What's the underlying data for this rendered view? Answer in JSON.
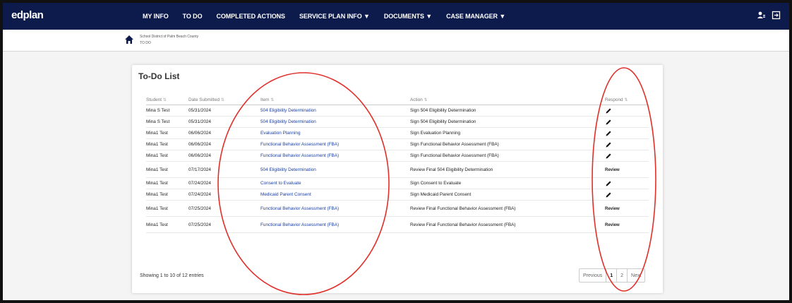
{
  "app": {
    "logo": "edplan"
  },
  "nav": [
    {
      "label": "MY INFO"
    },
    {
      "label": "TO DO"
    },
    {
      "label": "COMPLETED ACTIONS"
    },
    {
      "label": "SERVICE PLAN INFO ▼"
    },
    {
      "label": "DOCUMENTS ▼"
    },
    {
      "label": "CASE MANAGER ▼"
    }
  ],
  "breadcrumb": {
    "org": "School District of Palm Beach County",
    "page": "TO DO"
  },
  "todo": {
    "title": "To-Do List",
    "columns": [
      "Student",
      "Date Submitted",
      "Item",
      "Action",
      "Respond"
    ],
    "rows": [
      {
        "student": "Mina S Test",
        "date": "05/31/2024",
        "item": "504 Eligibility Determination",
        "action": "Sign 504 Eligibility Determination",
        "respond": ""
      },
      {
        "student": "Mina S Test",
        "date": "05/31/2024",
        "item": "504 Eligibility Determination",
        "action": "Sign 504 Eligibility Determination",
        "respond": ""
      },
      {
        "student": "Mina1 Test",
        "date": "06/06/2024",
        "item": "Evaluation Planning",
        "action": "Sign Evaluation Planning",
        "respond": ""
      },
      {
        "student": "Mina1 Test",
        "date": "06/06/2024",
        "item": "Functional Behavior Assessment (FBA)",
        "action": "Sign Functional Behavior Assessment (FBA)",
        "respond": ""
      },
      {
        "student": "Mina1 Test",
        "date": "06/06/2024",
        "item": "Functional Behavior Assessment (FBA)",
        "action": "Sign Functional Behavior Assessment (FBA)",
        "respond": ""
      },
      {
        "student": "Mina1 Test",
        "date": "07/17/2024",
        "item": "504 Eligibility Determination",
        "action": "Review Final 504 Eligibility Determination",
        "respond": "Review"
      },
      {
        "student": "Mina1 Test",
        "date": "07/24/2024",
        "item": "Consent to Evaluate",
        "action": "Sign Consent to Evaluate",
        "respond": ""
      },
      {
        "student": "Mina1 Test",
        "date": "07/24/2024",
        "item": "Medicaid Parent Consent",
        "action": "Sign Medicaid Parent Consent",
        "respond": ""
      },
      {
        "student": "Mina1 Test",
        "date": "07/25/2024",
        "item": "Functional Behavior Assessment (FBA)",
        "action": "Review Final Functional Behavior Assessment (FBA)",
        "respond": "Review"
      },
      {
        "student": "Mina1 Test",
        "date": "07/25/2024",
        "item": "Functional Behavior Assessment (FBA)",
        "action": "Review Final Functional Behavior Assessment (FBA)",
        "respond": "Review"
      }
    ],
    "entries_text": "Showing 1 to 10 of 12 entries",
    "pagination": {
      "prev": "Previous",
      "pages": [
        "1",
        "2"
      ],
      "next": "Next"
    }
  },
  "colors": {
    "nav_bg": "#0d1b4c",
    "link": "#1b3fa6",
    "annotation": "#e0302a"
  },
  "icons": {
    "home": "home-icon",
    "edit": "pencil-icon",
    "user": "user-icon",
    "logout": "logout-icon"
  }
}
